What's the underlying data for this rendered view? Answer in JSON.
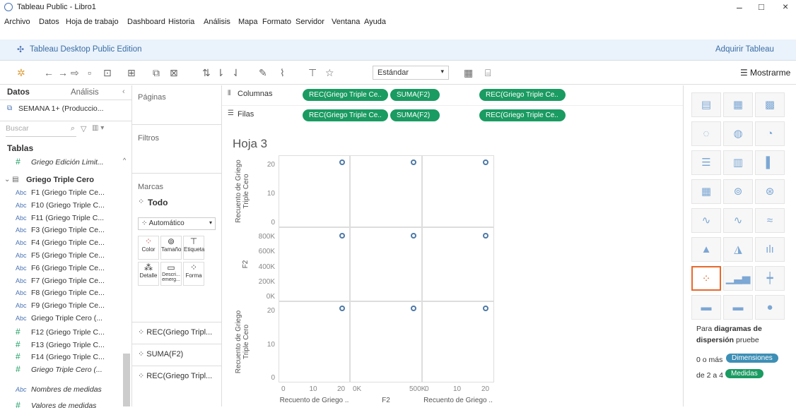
{
  "window": {
    "title": "Tableau Public - Libro1"
  },
  "menu": [
    "Archivo",
    "Datos",
    "Hoja de trabajo",
    "Dashboard",
    "Historia",
    "Análisis",
    "Mapa",
    "Formato",
    "Servidor",
    "Ventana",
    "Ayuda"
  ],
  "brand": {
    "edition": "Tableau Desktop Public Edition",
    "acquire": "Adquirir Tableau"
  },
  "toolbar": {
    "format_select": "Estándar",
    "show_me": "Mostrarme"
  },
  "data_pane": {
    "tab_data": "Datos",
    "tab_analysis": "Análisis",
    "source": "SEMANA 1+ (Produccio...",
    "search_placeholder": "Buscar",
    "tables_header": "Tablas",
    "prev_table_field": "Griego Edición Limit...",
    "table_name": "Griego Triple Cero",
    "fields": [
      {
        "type": "Abc",
        "name": "F1 (Griego Triple Ce..."
      },
      {
        "type": "Abc",
        "name": "F10 (Griego Triple C..."
      },
      {
        "type": "Abc",
        "name": "F11 (Griego Triple C..."
      },
      {
        "type": "Abc",
        "name": "F3 (Griego Triple Ce..."
      },
      {
        "type": "Abc",
        "name": "F4 (Griego Triple Ce..."
      },
      {
        "type": "Abc",
        "name": "F5 (Griego Triple Ce..."
      },
      {
        "type": "Abc",
        "name": "F6 (Griego Triple Ce..."
      },
      {
        "type": "Abc",
        "name": "F7 (Griego Triple Ce..."
      },
      {
        "type": "Abc",
        "name": "F8 (Griego Triple Ce..."
      },
      {
        "type": "Abc",
        "name": "F9 (Griego Triple Ce..."
      },
      {
        "type": "Abc",
        "name": "Griego Triple Cero (..."
      },
      {
        "type": "#",
        "name": "F12 (Griego Triple C..."
      },
      {
        "type": "#",
        "name": "F13 (Griego Triple C..."
      },
      {
        "type": "#",
        "name": "F14 (Griego Triple C..."
      },
      {
        "type": "#",
        "name": "Griego Triple Cero (..."
      }
    ],
    "measure_names": "Nombres de medidas",
    "measure_values": "Valores de medidas"
  },
  "cards": {
    "pages": "Páginas",
    "filters": "Filtros",
    "marks": "Marcas",
    "marks_all": "Todo",
    "mark_type": "Automático",
    "buttons": [
      "Color",
      "Tamaño",
      "Etiqueta",
      "Descri... emerg...",
      "Forma"
    ],
    "detail": "Detalle",
    "mark_tabs": [
      "REC(Griego Tripl...",
      "SUMA(F2)",
      "REC(Griego Tripl..."
    ]
  },
  "shelves": {
    "columns_label": "Columnas",
    "rows_label": "Filas",
    "pills": [
      "REC(Griego Triple Ce..",
      "SUMA(F2)",
      "REC(Griego Triple Ce.."
    ]
  },
  "view": {
    "sheet_title": "Hoja 3",
    "row_labels": [
      "Recuento de Griego Triple Cero",
      "F2",
      "Recuento de Griego Triple Cero"
    ],
    "row_ticks": [
      [
        "20",
        "10",
        "0"
      ],
      [
        "800K",
        "600K",
        "400K",
        "200K",
        "0K"
      ],
      [
        "20",
        "10",
        "0"
      ]
    ],
    "col_ticks": [
      [
        "0",
        "10",
        "20"
      ],
      [
        "0K",
        "500K"
      ],
      [
        "0",
        "10",
        "20"
      ]
    ],
    "col_labels": [
      "Recuento de Griego ..",
      "F2",
      "Recuento de Griego .."
    ]
  },
  "show_me": {
    "hint_prefix": "Para ",
    "hint_bold": "diagramas de dispersión",
    "hint_suffix": " pruebe",
    "dims_prefix": "0 o más",
    "dims": "Dimensiones",
    "meas_prefix": "de 2 a 4",
    "meas": "Medidas"
  },
  "colors": {
    "pill": "#1a9b61",
    "mark": "#4e79a7",
    "brand_bg": "#eaf2fb",
    "highlight": "#e8692d"
  }
}
